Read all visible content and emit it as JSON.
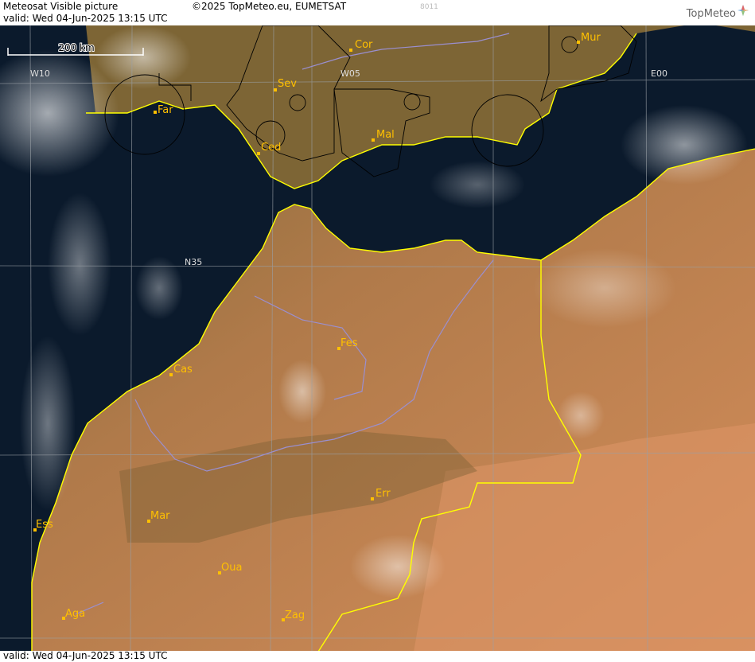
{
  "header": {
    "title": "Meteosat Visible picture",
    "valid": "valid:  Wed  04-Jun-2025  13:15 UTC",
    "copyright": "©2025 TopMeteo.eu, EUMETSAT",
    "code": "8011",
    "logo_text": "TopMeteo"
  },
  "footer": {
    "valid": "valid:  Wed  04-Jun-2025  13:15 UTC"
  },
  "map": {
    "scale_label": "200 km",
    "gridlines": {
      "longitudes": [
        "W10",
        "W05",
        "E00"
      ],
      "latitudes": [
        "N35"
      ]
    },
    "cities": [
      {
        "name": "Cor"
      },
      {
        "name": "Mur"
      },
      {
        "name": "Sev"
      },
      {
        "name": "Far"
      },
      {
        "name": "Ced"
      },
      {
        "name": "Mal"
      },
      {
        "name": "Fes"
      },
      {
        "name": "Cas"
      },
      {
        "name": "Err"
      },
      {
        "name": "Ess"
      },
      {
        "name": "Mar"
      },
      {
        "name": "Oua"
      },
      {
        "name": "Aga"
      },
      {
        "name": "Zag"
      }
    ],
    "colors": {
      "sea": "#0b1a2c",
      "land": "#b8784a",
      "coastline": "#ffff00",
      "rivers": "#9a8fd0",
      "airspace": "#000000",
      "city_label": "#ffc000",
      "gridline": "#9aa0a6"
    }
  }
}
